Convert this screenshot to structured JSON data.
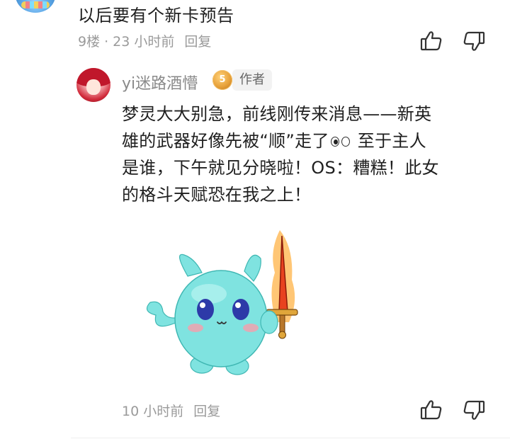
{
  "parent_comment": {
    "text": "以后要有个新卡预告",
    "floor": "9楼",
    "separator": "·",
    "time": "23 小时前",
    "reply_label": "回复"
  },
  "reply": {
    "username": "yi迷路酒懵",
    "level": "5",
    "role_tag": "作者",
    "text_lines": [
      "梦灵大大别急，前线刚传来消息——新英",
      "雄的武器好像先被“顺”走了",
      "是谁，下午就见分晓啦！OS：糟糕！此女",
      "的格斗天赋恐在我之上！"
    ],
    "text_line2_tail": " 至于主人",
    "sticker_icon": "cyan-creature-with-flaming-sword-sticker",
    "time": "10 小时前",
    "reply_label": "回复"
  },
  "icons": {
    "like": "thumbs-up-icon",
    "dislike": "thumbs-down-icon",
    "emoji": "eyes-emoji-icon"
  },
  "colors": {
    "text_primary": "#1f1f1f",
    "text_meta": "#9a9a9a",
    "tag_bg": "#f2f2f2",
    "sticker_body": "#7fe3e0"
  }
}
